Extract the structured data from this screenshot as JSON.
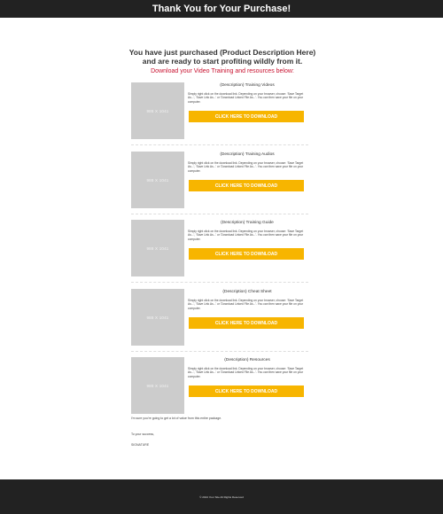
{
  "header": {
    "title": "Thank You for Your Purchase!"
  },
  "intro": {
    "headline": "You have just purchased (Product Description Here) and are ready to start profiting wildly from it.",
    "subhead": "Download your Video Training and resources below:"
  },
  "image_placeholder": "988 X 1041",
  "item_description": "Simply right click on the download link. Depending on your browser, choose: 'Save Target As...', 'Save Link As...' or 'Download Linked File As...'. You can then save your file on your computer.",
  "button_label": "CLICK HERE TO DOWNLOAD",
  "items": [
    {
      "title": "(Description) Training Videos"
    },
    {
      "title": "(Description) Training Audios"
    },
    {
      "title": "(Description) Training Guide"
    },
    {
      "title": "(Description) Cheat Sheet"
    },
    {
      "title": "(Description) Resources"
    }
  ],
  "closing": {
    "line1": "I'm sure you're going to get a lot of value from this entire package.",
    "line2": "To your success,",
    "signature": "SIGNATURE"
  },
  "footer": {
    "copyright": "© 2024 Your Site All Rights Reserved"
  },
  "colors": {
    "button": "#f7b500",
    "subhead": "#c8102e",
    "bar": "#222222"
  }
}
